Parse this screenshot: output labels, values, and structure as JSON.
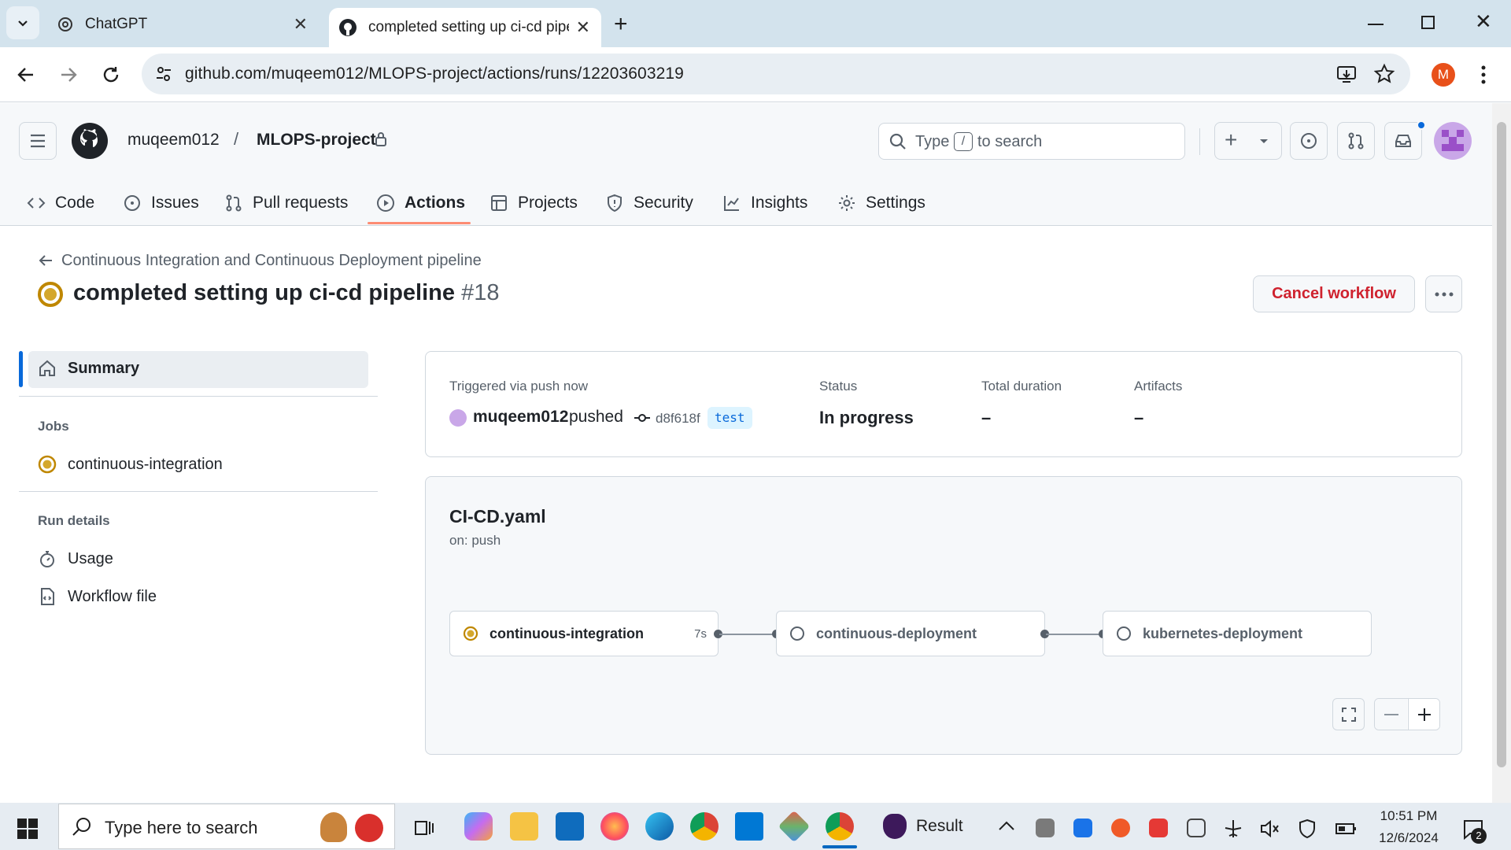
{
  "browser": {
    "tabs": [
      {
        "label": "ChatGPT",
        "active": false
      },
      {
        "label": "completed setting up ci-cd pipe",
        "active": true
      }
    ],
    "url": "github.com/muqeem012/MLOPS-project/actions/runs/12203603219",
    "profile_initial": "M"
  },
  "header": {
    "owner": "muqeem012",
    "separator": "/",
    "repo": "MLOPS-project",
    "search_prefix": "Type",
    "search_key": "/",
    "search_suffix": "to search"
  },
  "nav": {
    "tabs": [
      {
        "label": "Code",
        "icon": "code-icon"
      },
      {
        "label": "Issues",
        "icon": "issue-icon"
      },
      {
        "label": "Pull requests",
        "icon": "pull-request-icon"
      },
      {
        "label": "Actions",
        "icon": "play-icon",
        "active": true
      },
      {
        "label": "Projects",
        "icon": "table-icon"
      },
      {
        "label": "Security",
        "icon": "shield-icon"
      },
      {
        "label": "Insights",
        "icon": "graph-icon"
      },
      {
        "label": "Settings",
        "icon": "gear-icon"
      }
    ]
  },
  "run": {
    "workflow_name": "Continuous Integration and Continuous Deployment pipeline",
    "title": "completed setting up ci-cd pipeline",
    "number": "#18",
    "cancel_label": "Cancel workflow",
    "status_color": "#bf8700"
  },
  "sidebar": {
    "summary": "Summary",
    "jobs_heading": "Jobs",
    "jobs": [
      "continuous-integration"
    ],
    "run_details_heading": "Run details",
    "details": [
      {
        "label": "Usage",
        "icon": "stopwatch-icon"
      },
      {
        "label": "Workflow file",
        "icon": "file-code-icon"
      }
    ]
  },
  "summary": {
    "trigger": "Triggered via push now",
    "actor": "muqeem012",
    "action": "pushed",
    "commit": "d8f618f",
    "branch": "test",
    "status_label": "Status",
    "status_value": "In progress",
    "duration_label": "Total duration",
    "duration_value": "–",
    "artifacts_label": "Artifacts",
    "artifacts_value": "–"
  },
  "graph": {
    "file": "CI-CD.yaml",
    "event": "on: push",
    "jobs": [
      {
        "name": "continuous-integration",
        "state": "in_progress",
        "duration": "7s"
      },
      {
        "name": "continuous-deployment",
        "state": "queued",
        "duration": ""
      },
      {
        "name": "kubernetes-deployment",
        "state": "queued",
        "duration": ""
      }
    ]
  },
  "taskbar": {
    "search_placeholder": "Type here to search",
    "app_label": "Result",
    "time": "10:51 PM",
    "date": "12/6/2024",
    "notification_count": "2"
  }
}
